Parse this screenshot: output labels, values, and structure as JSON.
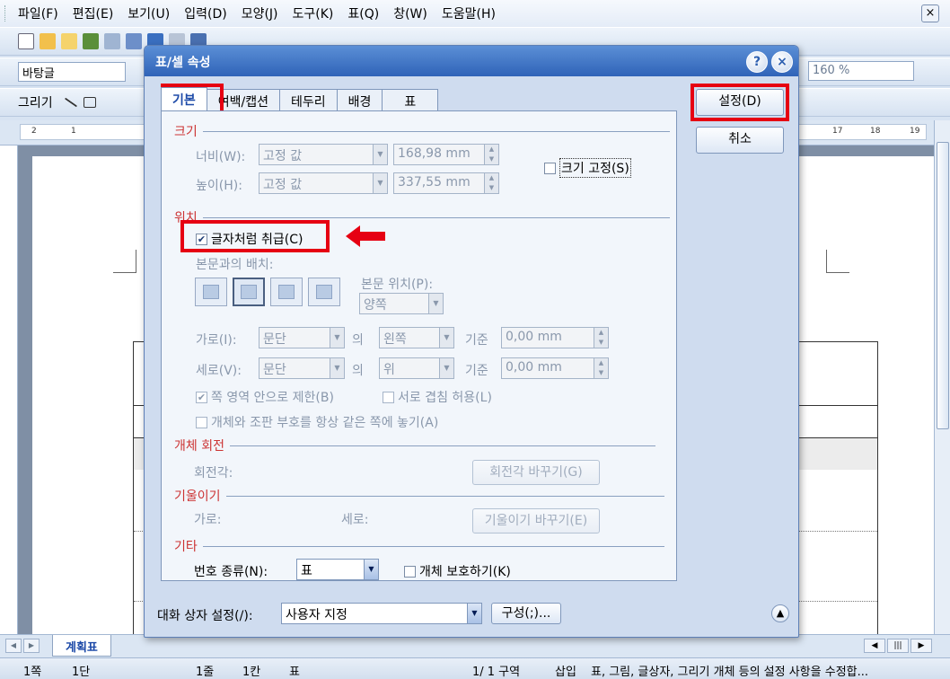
{
  "menu": [
    "파일(F)",
    "편집(E)",
    "보기(U)",
    "입력(D)",
    "모양(J)",
    "도구(K)",
    "표(Q)",
    "창(W)",
    "도움말(H)"
  ],
  "window_close": "×",
  "toolbar2": {
    "style_combo": "바탕글",
    "zoom_combo": "160 %"
  },
  "toolbar3": {
    "draw_label": "그리기"
  },
  "ruler": {
    "numbers": [
      "2",
      "1",
      "17",
      "18",
      "19"
    ]
  },
  "sheet_tab": "계획표",
  "status": {
    "page": "1쪽",
    "column": "1단",
    "line": "1줄",
    "col": "1칸",
    "mode_table": "표",
    "section": "1/   1 구역",
    "insert": "삽입",
    "hint": "표, 그림, 글상자, 그리기 개체 등의 설정 사항을 수정합..."
  },
  "dialog": {
    "title": "표/셀 속성",
    "help": "?",
    "close": "×",
    "tabs": [
      "기본",
      "여백/캡션",
      "테두리",
      "배경",
      "표"
    ],
    "ok_button": "설정(D)",
    "cancel_button": "취소",
    "size": {
      "header": "크기",
      "width_label": "너비(W):",
      "width_mode": "고정 값",
      "width_value": "168,98 mm",
      "height_label": "높이(H):",
      "height_mode": "고정 값",
      "height_value": "337,55 mm",
      "fix_size": "크기 고정(S)"
    },
    "position": {
      "header": "위치",
      "treat_as_char": "글자처럼 취급(C)",
      "treat_as_char_checked": true,
      "body_layout_label": "본문과의 배치:",
      "body_position_label": "본문 위치(P):",
      "body_position_value": "양쪽",
      "horiz_label": "가로(I):",
      "horiz_ref": "문단",
      "of1": "의",
      "horiz_align": "왼쪽",
      "basis1": "기준",
      "horiz_offset": "0,00 mm",
      "vert_label": "세로(V):",
      "vert_ref": "문단",
      "of2": "의",
      "vert_align": "위",
      "basis2": "기준",
      "vert_offset": "0,00 mm",
      "limit_page": "쪽 영역 안으로 제한(B)",
      "limit_page_checked": true,
      "allow_overlap": "서로 겹침 허용(L)",
      "keep_same_page": "개체와 조판 부호를 항상 같은 쪽에 놓기(A)"
    },
    "rotation": {
      "header": "개체 회전",
      "angle_label": "회전각:",
      "change_button": "회전각 바꾸기(G)"
    },
    "skew": {
      "header": "기울이기",
      "horiz_label": "가로:",
      "vert_label": "세로:",
      "change_button": "기울이기 바꾸기(E)"
    },
    "misc": {
      "header": "기타",
      "number_type_label": "번호 종류(N):",
      "number_type_value": "표",
      "protect_object": "개체 보호하기(K)"
    },
    "preset_label": "대화 상자 설정(/):",
    "preset_value": "사용자 지정",
    "configure_button": "구성(;)..."
  },
  "colors": {
    "highlight_red": "#e60012",
    "title_blue": "#2f63b8"
  }
}
